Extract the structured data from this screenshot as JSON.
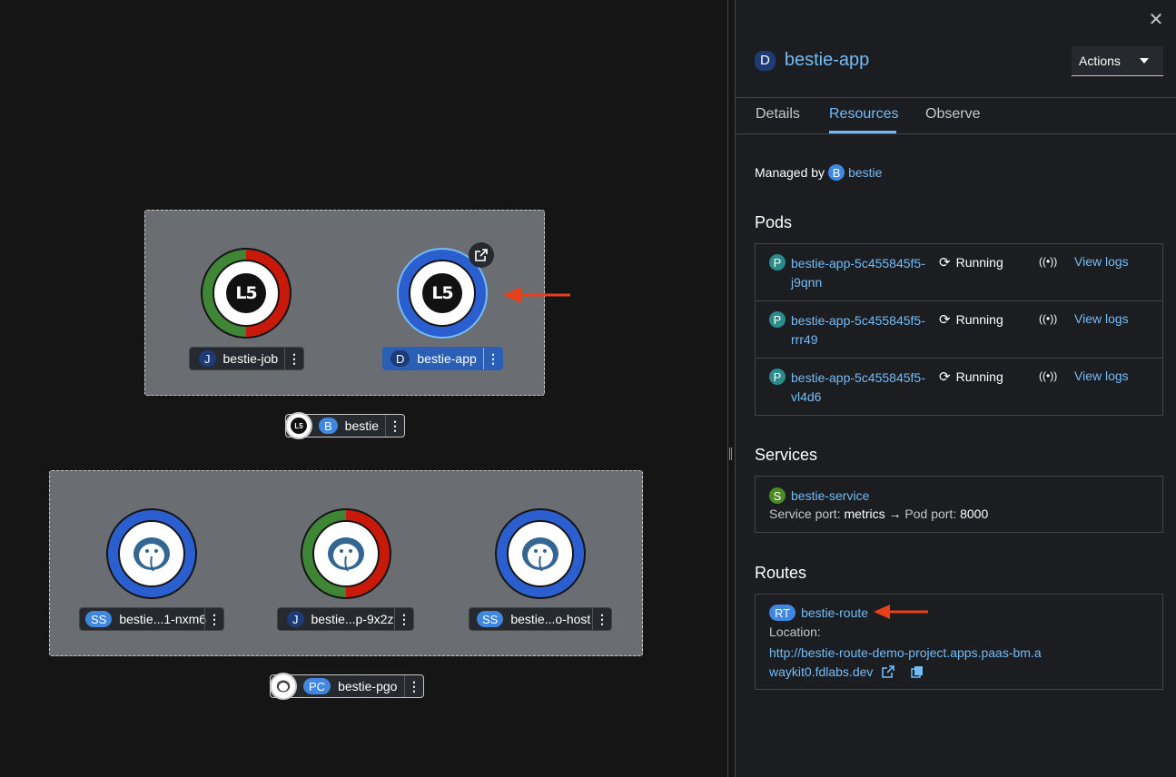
{
  "topology": {
    "group1": {
      "label": "bestie",
      "badge": "B",
      "icon_text": "L5",
      "nodes": [
        {
          "name": "bestie-job",
          "badge": "J",
          "icon_text": "L5"
        },
        {
          "name": "bestie-app",
          "badge": "D",
          "icon_text": "L5"
        }
      ]
    },
    "group2": {
      "label": "bestie-pgo",
      "badge": "PC",
      "nodes": [
        {
          "name": "bestie...1-nxm6",
          "badge": "SS"
        },
        {
          "name": "bestie...p-9x2z",
          "badge": "J"
        },
        {
          "name": "bestie...o-host",
          "badge": "SS"
        }
      ]
    },
    "kebab_symbol": "⋮"
  },
  "panel": {
    "close_symbol": "✕",
    "title": "bestie-app",
    "title_badge": "D",
    "actions_label": "Actions",
    "tabs": [
      "Details",
      "Resources",
      "Observe"
    ],
    "active_tab": "Resources",
    "managed_by_label": "Managed by",
    "managed_by_badge": "B",
    "managed_by_name": "bestie",
    "pods_heading": "Pods",
    "pods": [
      {
        "badge": "P",
        "name": "bestie-app-5c455845f5-j9qnn",
        "status": "Running",
        "logs": "View logs"
      },
      {
        "badge": "P",
        "name": "bestie-app-5c455845f5-rrr49",
        "status": "Running",
        "logs": "View logs"
      },
      {
        "badge": "P",
        "name": "bestie-app-5c455845f5-vl4d6",
        "status": "Running",
        "logs": "View logs"
      }
    ],
    "services_heading": "Services",
    "service": {
      "badge": "S",
      "name": "bestie-service",
      "port_label": "Service port:",
      "port_value": "metrics",
      "arrow": "→",
      "pod_port_label": "Pod port:",
      "pod_port_value": "8000"
    },
    "routes_heading": "Routes",
    "route": {
      "badge": "RT",
      "name": "bestie-route",
      "location_label": "Location:",
      "url": "http://bestie-route-demo-project.apps.paas-bm.awaykit0.fdlabs.dev"
    }
  },
  "colors": {
    "canvas_bg": "#151515",
    "panel_bg": "#1b1d21",
    "link": "#73bcf7",
    "ring_blue": "#2b5fd0",
    "ring_green": "#3e8635",
    "ring_red": "#c9190b",
    "arrow": "#e8401c"
  }
}
